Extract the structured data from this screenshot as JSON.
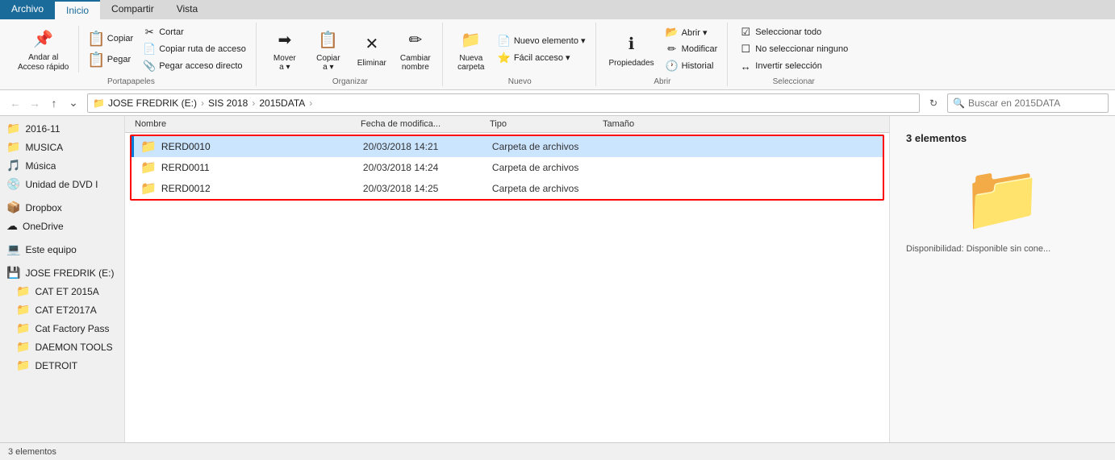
{
  "ribbon": {
    "tabs": [
      {
        "id": "archivo",
        "label": "Archivo"
      },
      {
        "id": "inicio",
        "label": "Inicio",
        "active": true
      },
      {
        "id": "compartir",
        "label": "Compartir"
      },
      {
        "id": "vista",
        "label": "Vista"
      }
    ],
    "groups": {
      "portapapeles": {
        "label": "Portapapeles",
        "buttons": {
          "andar": "Andar al\nAcceso rápido",
          "copiar": "Copiar",
          "pegar": "Pegar",
          "cortar": "Cortar",
          "copiar_ruta": "Copiar ruta de acceso",
          "pegar_acceso": "Pegar acceso directo"
        }
      },
      "organizar": {
        "label": "Organizar",
        "mover_a": "Mover\na ▾",
        "copiar_a": "Copiar\na ▾",
        "eliminar": "Eliminar",
        "cambiar_nombre": "Cambiar\nnombre"
      },
      "nuevo": {
        "label": "Nuevo",
        "nueva_carpeta": "Nueva\ncarpeta",
        "nuevo_elemento": "Nuevo elemento ▾",
        "facil_acceso": "Fácil acceso ▾"
      },
      "abrir": {
        "label": "Abrir",
        "abrir": "Abrir ▾",
        "modificar": "Modificar",
        "historial": "Historial",
        "propiedades": "Propiedades"
      },
      "seleccionar": {
        "label": "Seleccionar",
        "todo": "Seleccionar todo",
        "ninguno": "No seleccionar ninguno",
        "invertir": "Invertir selección"
      }
    }
  },
  "breadcrumb": {
    "parts": [
      "JOSE FREDRIK (E:)",
      "SIS 2018",
      "2015DATA"
    ],
    "search_placeholder": "Buscar en 2015DATA"
  },
  "sidebar": {
    "items": [
      {
        "id": "2016-11",
        "label": "2016-11",
        "icon": "📁"
      },
      {
        "id": "musica-folder",
        "label": "MUSICA",
        "icon": "📁"
      },
      {
        "id": "musica-lib",
        "label": "Música",
        "icon": "🎵"
      },
      {
        "id": "dvd",
        "label": "Unidad de DVD I",
        "icon": "💿"
      },
      {
        "id": "dropbox",
        "label": "Dropbox",
        "icon": "📦"
      },
      {
        "id": "onedrive",
        "label": "OneDrive",
        "icon": "☁"
      },
      {
        "id": "este-equipo",
        "label": "Este equipo",
        "icon": "💻"
      },
      {
        "id": "jose-fredrik",
        "label": "JOSE FREDRIK (E:)",
        "icon": "💾"
      },
      {
        "id": "cat-et-2015a",
        "label": "CAT ET 2015A",
        "icon": "📁"
      },
      {
        "id": "cat-et-2017a",
        "label": "CAT ET2017A",
        "icon": "📁"
      },
      {
        "id": "cat-factory",
        "label": "Cat Factory Pass",
        "icon": "📁"
      },
      {
        "id": "daemon-tools",
        "label": "DAEMON TOOLS",
        "icon": "📁"
      },
      {
        "id": "detroit",
        "label": "DETROIT",
        "icon": "📁"
      }
    ]
  },
  "files": {
    "columns": {
      "name": "Nombre",
      "date": "Fecha de modifica...",
      "type": "Tipo",
      "size": "Tamaño"
    },
    "rows": [
      {
        "id": "rerd0010",
        "name": "RERD0010",
        "date": "20/03/2018 14:21",
        "type": "Carpeta de archivos",
        "size": "",
        "selected": true
      },
      {
        "id": "rerd0011",
        "name": "RERD0011",
        "date": "20/03/2018 14:24",
        "type": "Carpeta de archivos",
        "size": ""
      },
      {
        "id": "rerd0012",
        "name": "RERD0012",
        "date": "20/03/2018 14:25",
        "type": "Carpeta de archivos",
        "size": ""
      }
    ]
  },
  "details": {
    "count": "3 elementos",
    "availability_label": "Disponibilidad:",
    "availability_value": "Disponible sin cone..."
  },
  "status": {
    "text": "3 elementos"
  }
}
